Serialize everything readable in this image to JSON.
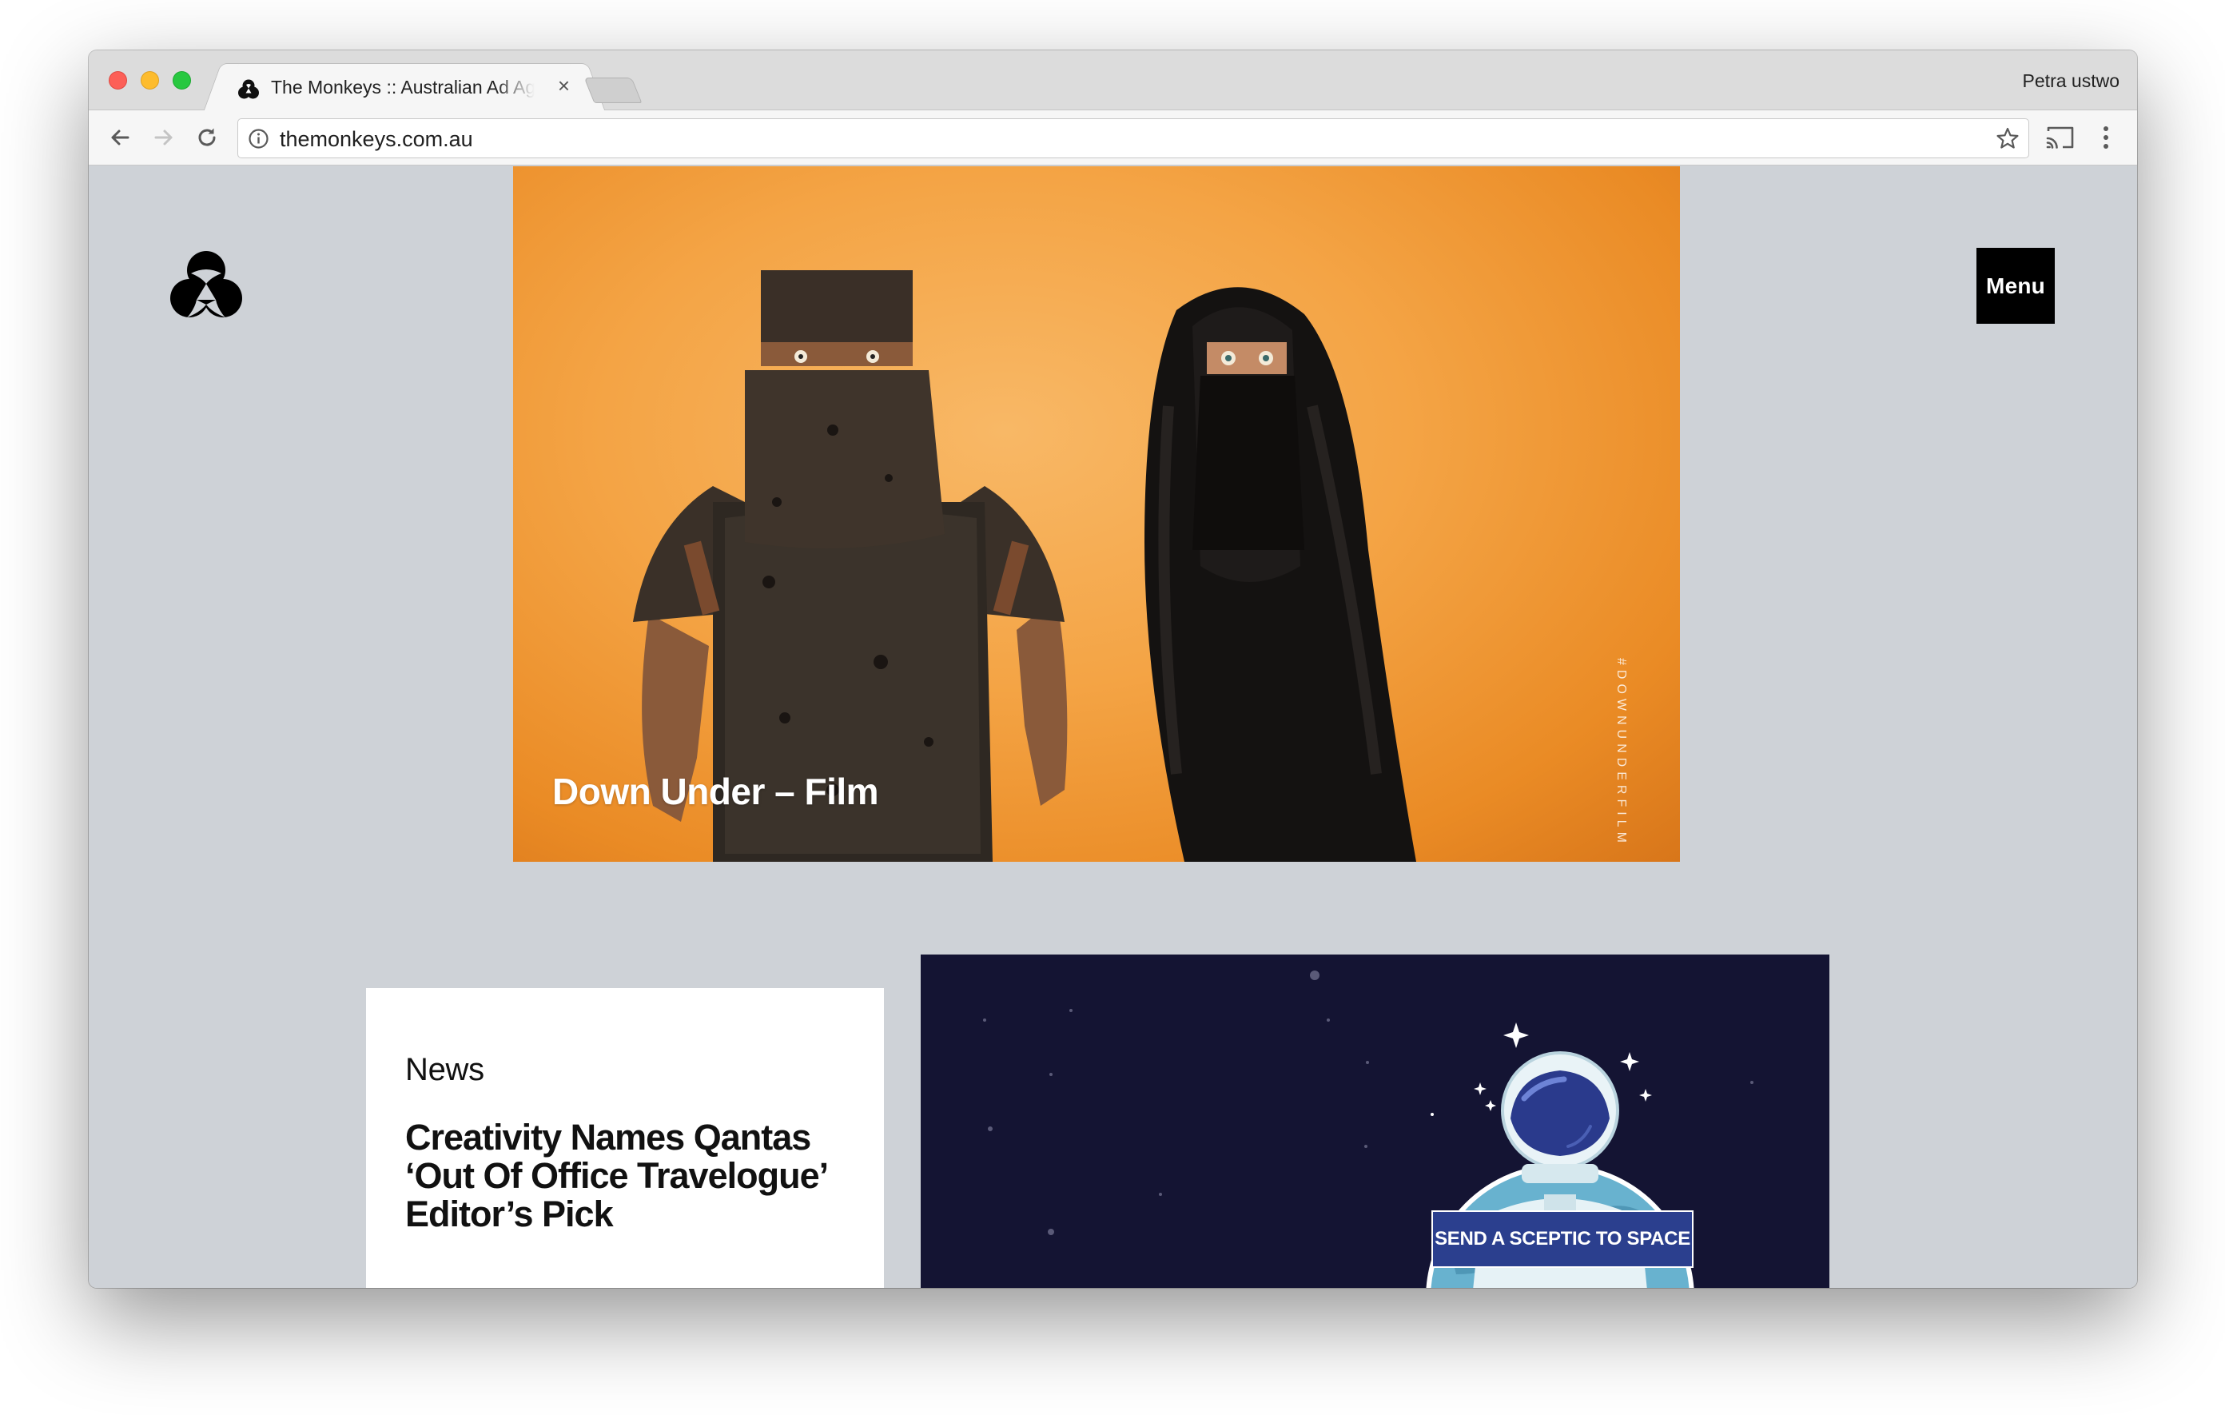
{
  "browser": {
    "tab_title": "The Monkeys :: Australian Ad Agency",
    "profile_name": "Petra ustwo",
    "address": "themonkeys.com.au",
    "tab_close_glyph": "×"
  },
  "icons": {
    "back": "arrow-left-icon",
    "forward": "arrow-right-icon",
    "reload": "reload-icon",
    "info": "info-icon",
    "bookmark": "star-icon",
    "cast": "cast-icon",
    "menu": "kebab-menu-icon",
    "logo": "monkeys-logo-icon"
  },
  "site": {
    "menu_label": "Menu",
    "hero": {
      "title": "Down Under – Film",
      "hashtag": "#DOWNUNDERFILM"
    },
    "news": {
      "category": "News",
      "headline": "Creativity Names Qantas ‘Out Of Office Travelogue’ Editor’s Pick"
    },
    "promo": {
      "banner_text": "SEND A SCEPTIC TO SPACE"
    }
  },
  "colors": {
    "page_background": "#ced2d7",
    "hero_background": "#f4a445",
    "space_background": "#141433",
    "banner_blue": "#2b3f8e"
  }
}
